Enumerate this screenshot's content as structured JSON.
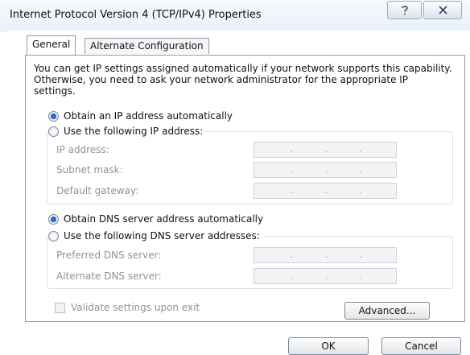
{
  "window": {
    "title": "Internet Protocol Version 4 (TCP/IPv4) Properties"
  },
  "titlebar_buttons": {
    "help_icon": "help-question-icon",
    "close_icon": "close-x-icon"
  },
  "tabs": [
    {
      "label": "General",
      "active": true
    },
    {
      "label": "Alternate Configuration",
      "active": false
    }
  ],
  "intro_text": "You can get IP settings assigned automatically if your network supports this capability. Otherwise, you need to ask your network administrator for the appropriate IP settings.",
  "ip_section": {
    "auto_label": "Obtain an IP address automatically",
    "auto_checked": true,
    "manual_label": "Use the following IP address:",
    "manual_checked": false,
    "fields": [
      {
        "label": "IP address:",
        "value": ". . ."
      },
      {
        "label": "Subnet mask:",
        "value": ". . ."
      },
      {
        "label": "Default gateway:",
        "value": ". . ."
      }
    ]
  },
  "dns_section": {
    "auto_label": "Obtain DNS server address automatically",
    "auto_checked": true,
    "manual_label": "Use the following DNS server addresses:",
    "manual_checked": false,
    "fields": [
      {
        "label": "Preferred DNS server:",
        "value": ". . ."
      },
      {
        "label": "Alternate DNS server:",
        "value": ". . ."
      }
    ]
  },
  "validate": {
    "label": "Validate settings upon exit",
    "checked": false
  },
  "buttons": {
    "advanced": "Advanced...",
    "ok": "OK",
    "cancel": "Cancel"
  },
  "colors": {
    "accent_radio": "#2b74d6",
    "disabled_text": "#8f9398",
    "border": "#8e9aab"
  }
}
